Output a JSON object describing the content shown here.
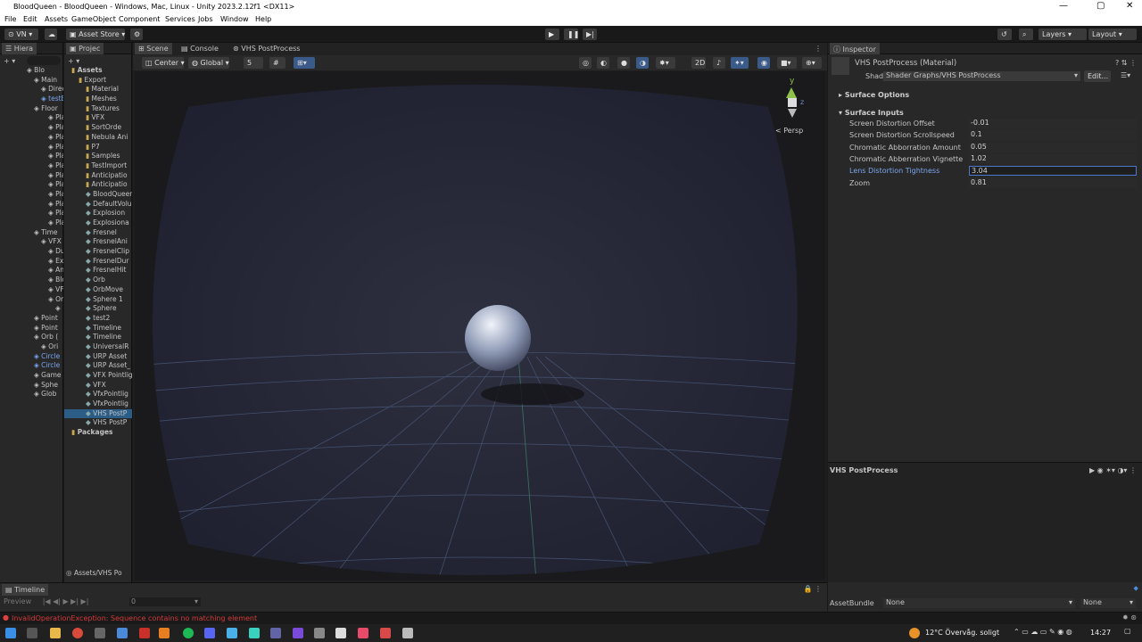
{
  "window": {
    "title": "BloodQueen - BloodQueen - Windows, Mac, Linux - Unity 2023.2.12f1 <DX11>"
  },
  "menu": [
    "File",
    "Edit",
    "Assets",
    "GameObject",
    "Component",
    "Services",
    "Jobs",
    "Window",
    "Help"
  ],
  "toolbar": {
    "account": "VN",
    "asset_store": "Asset Store",
    "layers": "Layers",
    "layout": "Layout"
  },
  "hierarchy": {
    "tab": "Hiera",
    "items": [
      "Blo",
      "Main",
      "Direc",
      "testE",
      "Floor",
      "Pla",
      "Pla",
      "Pla",
      "Pla",
      "Pla",
      "Pla",
      "Pla",
      "Pla",
      "Pla",
      "Pla",
      "Pla",
      "Pla",
      "Time",
      "VFX",
      "Du",
      "Ex",
      "An",
      "Blo",
      "VF",
      "Or",
      "",
      "Point",
      "Point",
      "Orb (",
      "Ori",
      "Circle",
      "Circle",
      "Game",
      "Sphe",
      "Glob"
    ]
  },
  "project": {
    "tab": "Projec",
    "items": [
      "Assets",
      "Export",
      "Material",
      "Meshes",
      "Textures",
      "VFX",
      "SortOrde",
      "Nebula Ani",
      "P7",
      "Samples",
      "TestImport",
      "Anticipatio",
      "Anticipatio",
      "BloodQueen",
      "DefaultVolu",
      "Explosion",
      "Explosiona",
      "Fresnel",
      "FresnelAni",
      "FresnelClip",
      "FresnelDur",
      "FresnelHit",
      "Orb",
      "OrbMove",
      "Sphere 1",
      "Sphere",
      "test2",
      "Timeline",
      "Timeline",
      "UniversalR",
      "URP Asset",
      "URP Asset_",
      "VFX Pointlig",
      "VFX",
      "VfxPointlig",
      "VfxPointlig",
      "VHS PostP",
      "VHS PostP",
      "Packages"
    ],
    "path": "Assets/VHS Po"
  },
  "scene": {
    "tabs": [
      "Scene",
      "Console",
      "VHS PostProcess"
    ],
    "pivot": "Center",
    "space": "Global",
    "grid_value": "5",
    "mode_2d": "2D",
    "persp_label": "< Persp",
    "gizmo_axes": {
      "y": "y",
      "z": "z"
    }
  },
  "inspector": {
    "tab": "Inspector",
    "material_title": "VHS PostProcess (Material)",
    "shader_label": "Shader",
    "shader_value": "Shader Graphs/VHS PostProcess",
    "edit_button": "Edit...",
    "surface_options": "Surface Options",
    "surface_inputs": "Surface Inputs",
    "properties": [
      {
        "label": "Screen Distortion Offset",
        "value": "-0.01"
      },
      {
        "label": "Screen Distortion Scrollspeed",
        "value": "0.1"
      },
      {
        "label": "Chromatic Abborration Amount",
        "value": "0.05"
      },
      {
        "label": "Chromatic Abberration Vignette",
        "value": "1.02"
      },
      {
        "label": "Lens Distortion Tightness",
        "value": "3.04"
      },
      {
        "label": "Zoom",
        "value": "0.81"
      }
    ],
    "preview_title": "VHS PostProcess"
  },
  "timeline": {
    "tab": "Timeline",
    "preview": "Preview",
    "frame": "0"
  },
  "asset_bundle": {
    "label": "AssetBundle",
    "value": "None",
    "variant": "None"
  },
  "status": {
    "error": "InvalidOperationException: Sequence contains no matching element"
  },
  "taskbar": {
    "weather": "12°C  Övervåg. soligt",
    "time": "14:27"
  },
  "colors": {
    "accent": "#4d78cc",
    "error": "#e04040",
    "link": "#7aa7f0"
  }
}
